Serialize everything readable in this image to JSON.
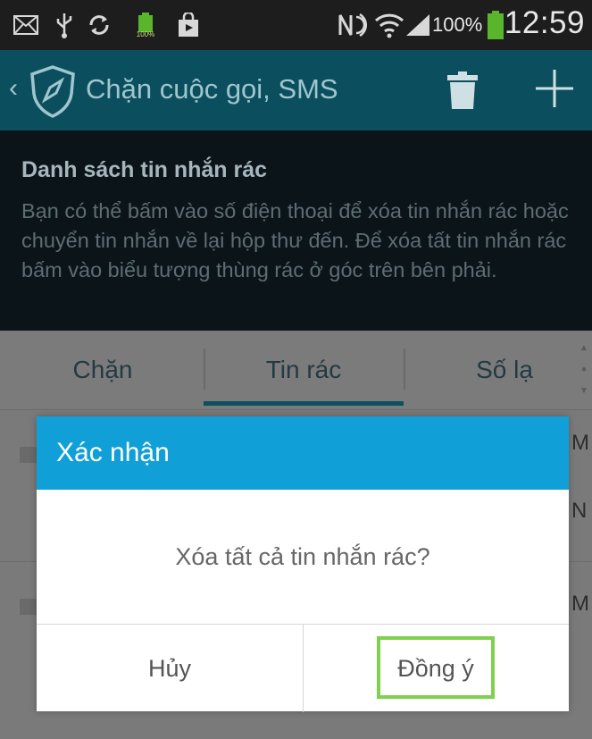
{
  "status_bar": {
    "icons": [
      "mail-icon",
      "usb-icon",
      "sync-icon",
      "battery-small-icon",
      "shopping-bag-icon",
      "nfc-icon",
      "wifi-icon",
      "signal-icon",
      "battery-icon"
    ],
    "mini_battery_label": "100%",
    "battery_percent": "100%",
    "time": "12:59"
  },
  "action_bar": {
    "back_glyph": "‹",
    "title": "Chặn cuộc gọi, SMS",
    "actions": [
      "trash-icon",
      "plus-icon"
    ]
  },
  "info": {
    "heading": "Danh sách tin nhắn rác",
    "body": "Bạn có thể bấm vào số điện thoại để xóa tin nhắn rác hoặc chuyển tin nhắn về lại hộp thư đến. Để xóa tất tin nhắn rác bấm vào biểu tượng thùng rác ở góc trên bên phải."
  },
  "tabs": [
    {
      "label": "Chặn",
      "active": false
    },
    {
      "label": "Tin rác",
      "active": true
    },
    {
      "label": "Số lạ",
      "active": false
    }
  ],
  "list_peek": [
    "M",
    "N",
    "M"
  ],
  "dialog": {
    "title": "Xác nhận",
    "message": "Xóa tất cả tin nhắn rác?",
    "cancel_label": "Hủy",
    "ok_label": "Đồng ý"
  },
  "colors": {
    "action_bar": "#0b4f5e",
    "dialog_header": "#109fd7",
    "highlight": "#7ed14e"
  }
}
